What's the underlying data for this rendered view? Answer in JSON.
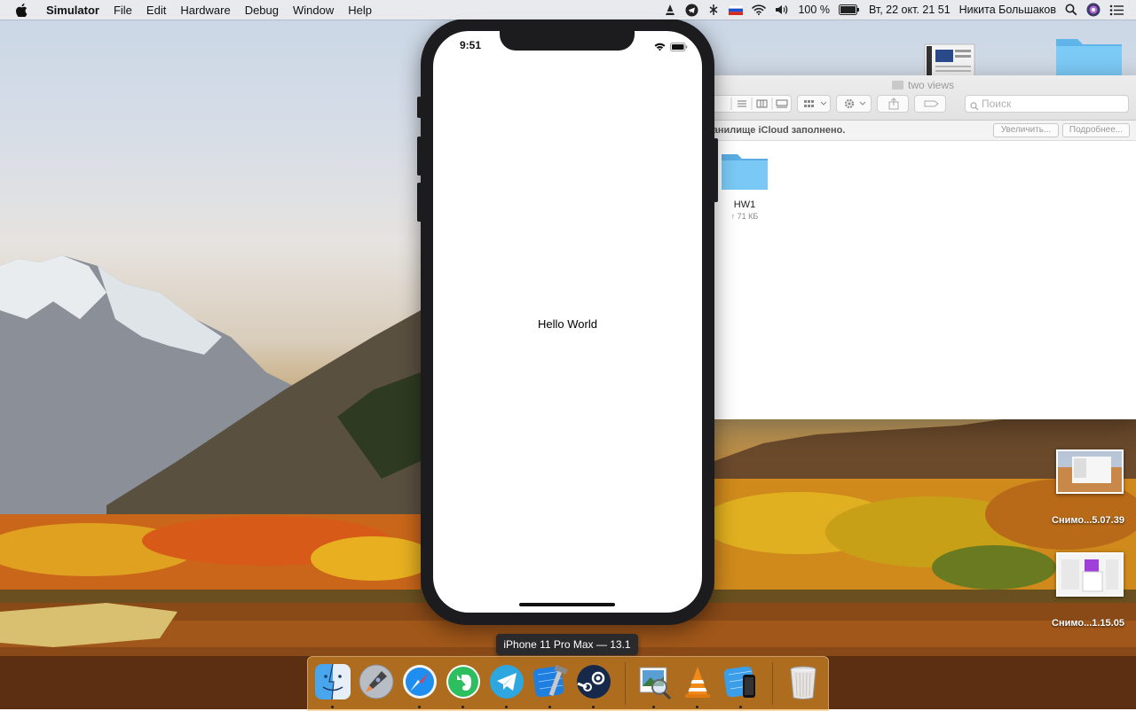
{
  "menubar": {
    "app_name": "Simulator",
    "menus": [
      "File",
      "Edit",
      "Hardware",
      "Debug",
      "Window",
      "Help"
    ],
    "battery": "100 %",
    "datetime": "Вт, 22 окт.  21 51",
    "user": "Никита Большаков"
  },
  "finder": {
    "title": "two views",
    "search_placeholder": "Поиск",
    "icloud_message": "ранилище iCloud заполнено.",
    "upgrade_label": "Увеличить...",
    "more_label": "Подробнее...",
    "items": [
      {
        "name": "HW1",
        "size": "↑ 71 КБ"
      }
    ]
  },
  "simulator": {
    "status_time": "9:51",
    "content_text": "Hello World",
    "device_tooltip": "iPhone 11 Pro Max — 13.1"
  },
  "desktop": {
    "items": [
      {
        "label": "Снимо...5.07.39"
      },
      {
        "label": "Снимо...1.15.05"
      }
    ]
  },
  "dock": {
    "apps": [
      "finder-icon",
      "launchpad-icon",
      "safari-icon",
      "evernote-icon",
      "telegram-icon",
      "xcode-icon",
      "steam-icon",
      "preview-icon",
      "vlc-icon",
      "simulator-icon",
      "trash-icon"
    ]
  },
  "colors": {
    "folder_blue": "#6cc0f0",
    "phone_bezel": "#1c1c1e",
    "tooltip_bg": "#2a2a2c"
  }
}
